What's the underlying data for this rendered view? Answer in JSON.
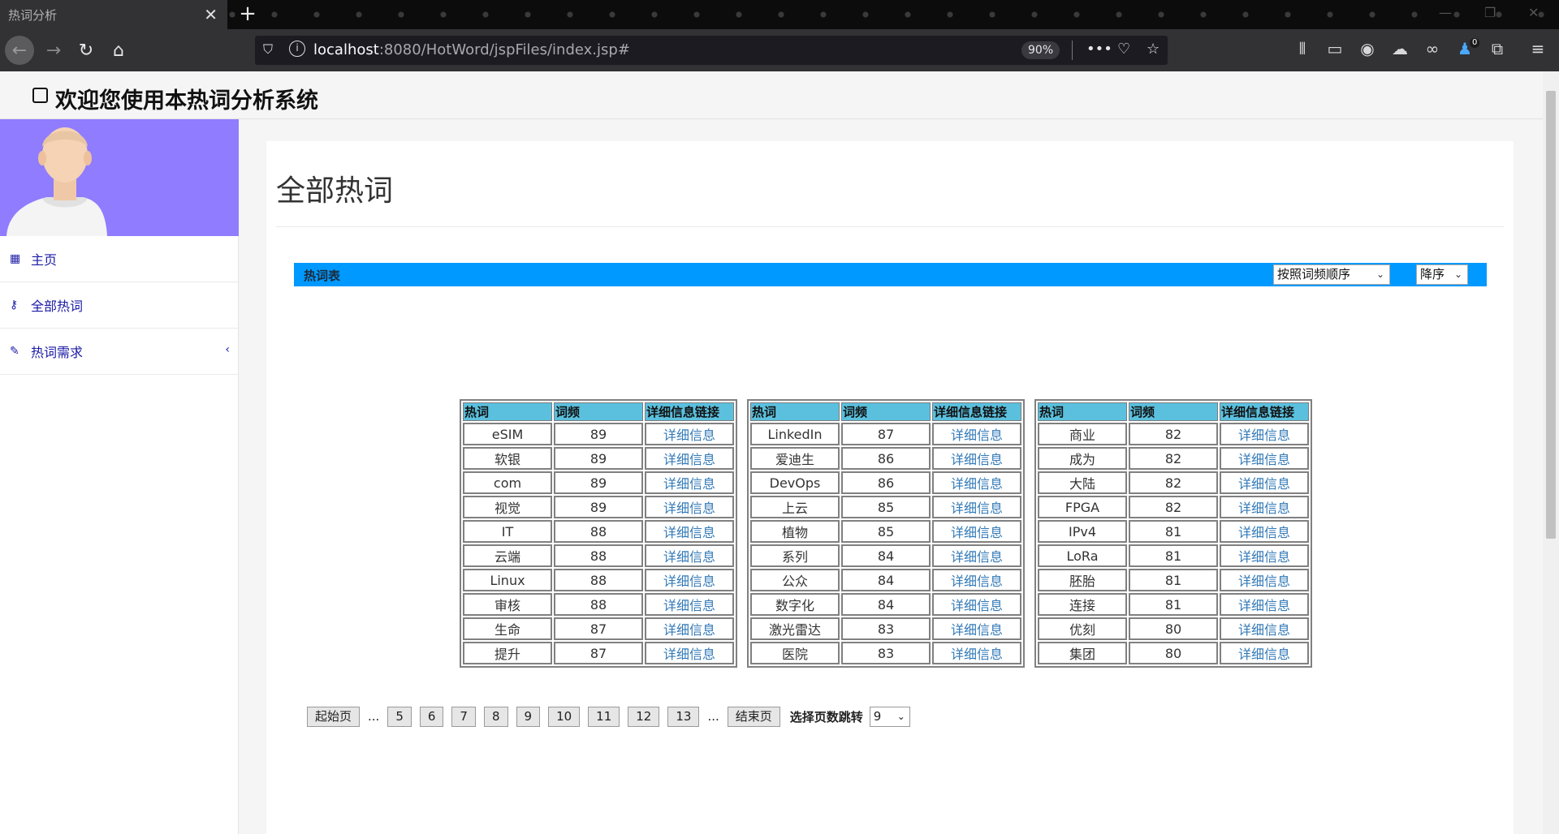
{
  "browser": {
    "tab_title": "热词分析",
    "url_host": "localhost",
    "url_rest": ":8080/HotWord/jspFiles/index.jsp#",
    "zoom": "90%",
    "notification_badge": "0"
  },
  "app": {
    "title": "欢迎您使用本热词分析系统"
  },
  "sidebar": {
    "items": [
      {
        "label": "主页",
        "icon": "table-icon"
      },
      {
        "label": "全部热词",
        "icon": "key-icon"
      },
      {
        "label": "热词需求",
        "icon": "edit-icon"
      }
    ]
  },
  "main": {
    "heading": "全部热词",
    "table_title": "热词表",
    "sort_by": "按照词频顺序",
    "sort_order": "降序",
    "columns": [
      "热词",
      "词频",
      "详细信息链接"
    ],
    "link_label": "详细信息",
    "groups": [
      [
        {
          "word": "eSIM",
          "freq": "89"
        },
        {
          "word": "软银",
          "freq": "89"
        },
        {
          "word": "com",
          "freq": "89"
        },
        {
          "word": "视觉",
          "freq": "89"
        },
        {
          "word": "IT",
          "freq": "88"
        },
        {
          "word": "云端",
          "freq": "88"
        },
        {
          "word": "Linux",
          "freq": "88"
        },
        {
          "word": "审核",
          "freq": "88"
        },
        {
          "word": "生命",
          "freq": "87"
        },
        {
          "word": "提升",
          "freq": "87"
        }
      ],
      [
        {
          "word": "LinkedIn",
          "freq": "87"
        },
        {
          "word": "爱迪生",
          "freq": "86"
        },
        {
          "word": "DevOps",
          "freq": "86"
        },
        {
          "word": "上云",
          "freq": "85"
        },
        {
          "word": "植物",
          "freq": "85"
        },
        {
          "word": "系列",
          "freq": "84"
        },
        {
          "word": "公众",
          "freq": "84"
        },
        {
          "word": "数字化",
          "freq": "84"
        },
        {
          "word": "激光雷达",
          "freq": "83"
        },
        {
          "word": "医院",
          "freq": "83"
        }
      ],
      [
        {
          "word": "商业",
          "freq": "82"
        },
        {
          "word": "成为",
          "freq": "82"
        },
        {
          "word": "大陆",
          "freq": "82"
        },
        {
          "word": "FPGA",
          "freq": "82"
        },
        {
          "word": "IPv4",
          "freq": "81"
        },
        {
          "word": "LoRa",
          "freq": "81"
        },
        {
          "word": "胚胎",
          "freq": "81"
        },
        {
          "word": "连接",
          "freq": "81"
        },
        {
          "word": "优刻",
          "freq": "80"
        },
        {
          "word": "集团",
          "freq": "80"
        }
      ]
    ]
  },
  "pager": {
    "first": "起始页",
    "ellipsis": "...",
    "pages": [
      "5",
      "6",
      "7",
      "8",
      "9",
      "10",
      "11",
      "12",
      "13"
    ],
    "last": "结束页",
    "jump_label": "选择页数跳转",
    "jump_value": "9"
  }
}
